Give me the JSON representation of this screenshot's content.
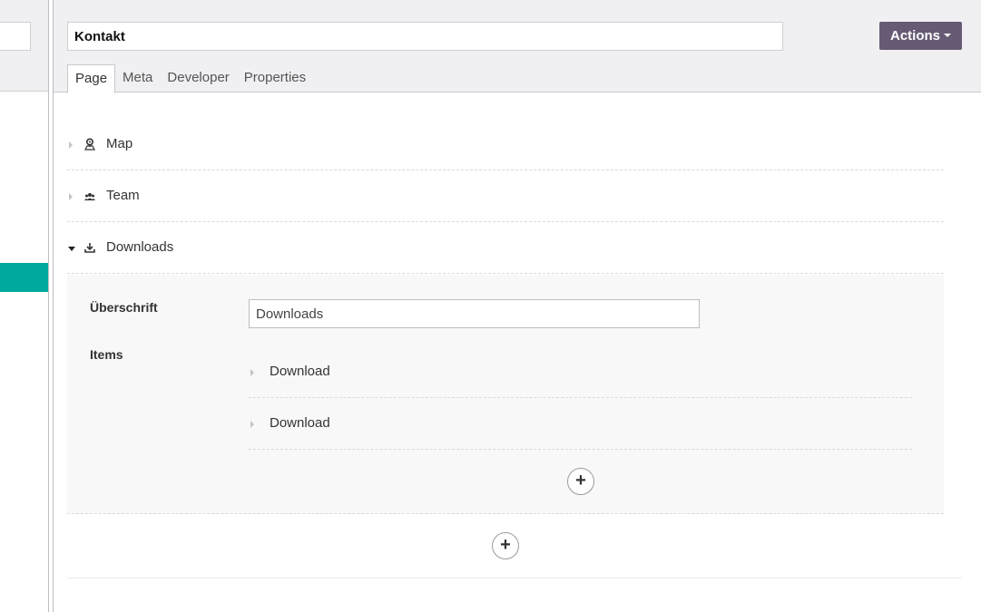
{
  "page": {
    "title_value": "Kontakt",
    "actions_label": "Actions"
  },
  "tabs": [
    {
      "label": "Page",
      "active": true
    },
    {
      "label": "Meta",
      "active": false
    },
    {
      "label": "Developer",
      "active": false
    },
    {
      "label": "Properties",
      "active": false
    }
  ],
  "blocks": [
    {
      "label": "Map",
      "icon": "map-pin-icon",
      "expanded": false
    },
    {
      "label": "Team",
      "icon": "team-icon",
      "expanded": false
    },
    {
      "label": "Downloads",
      "icon": "download-icon",
      "expanded": true
    }
  ],
  "downloads_block": {
    "heading_label": "Überschrift",
    "heading_value": "Downloads",
    "items_label": "Items",
    "items": [
      {
        "label": "Download"
      },
      {
        "label": "Download"
      }
    ],
    "add_item_symbol": "+"
  },
  "add_block_symbol": "+",
  "colors": {
    "accent": "#665a74",
    "sidebar_active": "#00a99d",
    "header_bg": "#f0f0f3"
  }
}
